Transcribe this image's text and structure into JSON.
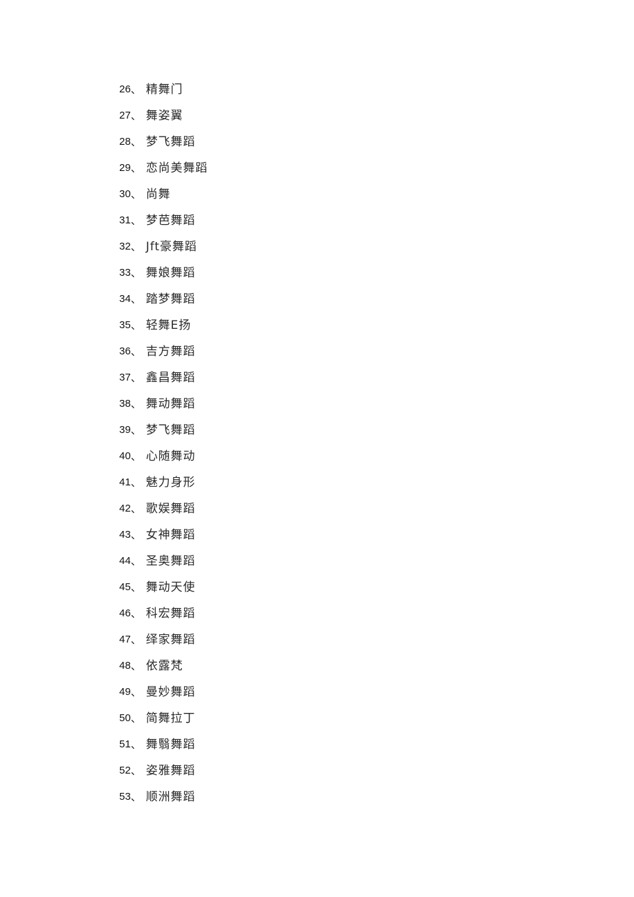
{
  "document": {
    "separator": "、",
    "items": [
      {
        "number": "26",
        "text": "精舞门"
      },
      {
        "number": "27",
        "text": "舞姿翼"
      },
      {
        "number": "28",
        "text": "梦飞舞蹈"
      },
      {
        "number": "29",
        "text": "恋尚美舞蹈"
      },
      {
        "number": "30",
        "text": "尚舞"
      },
      {
        "number": "31",
        "text": "梦芭舞蹈"
      },
      {
        "number": "32",
        "text": "Jft豪舞蹈"
      },
      {
        "number": "33",
        "text": "舞娘舞蹈"
      },
      {
        "number": "34",
        "text": "踏梦舞蹈"
      },
      {
        "number": "35",
        "text": "轻舞E扬"
      },
      {
        "number": "36",
        "text": "吉方舞蹈"
      },
      {
        "number": "37",
        "text": "鑫昌舞蹈"
      },
      {
        "number": "38",
        "text": "舞动舞蹈"
      },
      {
        "number": "39",
        "text": "梦飞舞蹈"
      },
      {
        "number": "40",
        "text": "心随舞动"
      },
      {
        "number": "41",
        "text": "魅力身形"
      },
      {
        "number": "42",
        "text": "歌娱舞蹈"
      },
      {
        "number": "43",
        "text": "女神舞蹈"
      },
      {
        "number": "44",
        "text": "圣奥舞蹈"
      },
      {
        "number": "45",
        "text": "舞动天使"
      },
      {
        "number": "46",
        "text": "科宏舞蹈"
      },
      {
        "number": "47",
        "text": "绎家舞蹈"
      },
      {
        "number": "48",
        "text": "依露梵"
      },
      {
        "number": "49",
        "text": "曼妙舞蹈"
      },
      {
        "number": "50",
        "text": "简舞拉丁"
      },
      {
        "number": "51",
        "text": "舞翳舞蹈"
      },
      {
        "number": "52",
        "text": "姿雅舞蹈"
      },
      {
        "number": "53",
        "text": "顺洲舞蹈"
      }
    ]
  }
}
